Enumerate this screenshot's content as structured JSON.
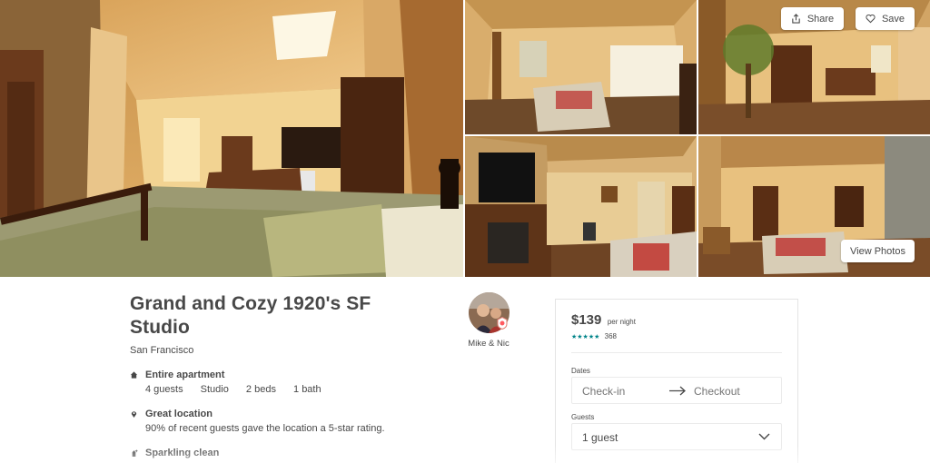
{
  "gallery": {
    "share_label": "Share",
    "save_label": "Save",
    "view_photos_label": "View Photos"
  },
  "listing": {
    "title": "Grand and Cozy 1920's SF Studio",
    "city": "San Francisco"
  },
  "host": {
    "name": "Mike & Nic"
  },
  "features": [
    {
      "icon": "home-icon",
      "title": "Entire apartment",
      "details": [
        "4 guests",
        "Studio",
        "2 beds",
        "1 bath"
      ]
    },
    {
      "icon": "location-pin-icon",
      "title": "Great location",
      "text": "90% of recent guests gave the location a 5-star rating."
    },
    {
      "icon": "sparkle-icon",
      "title": "Sparkling clean"
    }
  ],
  "booking": {
    "price": "$139",
    "per_night": "per night",
    "stars": "★★★★★",
    "review_count": "368",
    "dates_label": "Dates",
    "checkin_placeholder": "Check-in",
    "checkout_placeholder": "Checkout",
    "guests_label": "Guests",
    "guests_value": "1 guest"
  },
  "colors": {
    "text": "#484848",
    "accent_teal": "#008489",
    "border": "#ebebeb"
  }
}
